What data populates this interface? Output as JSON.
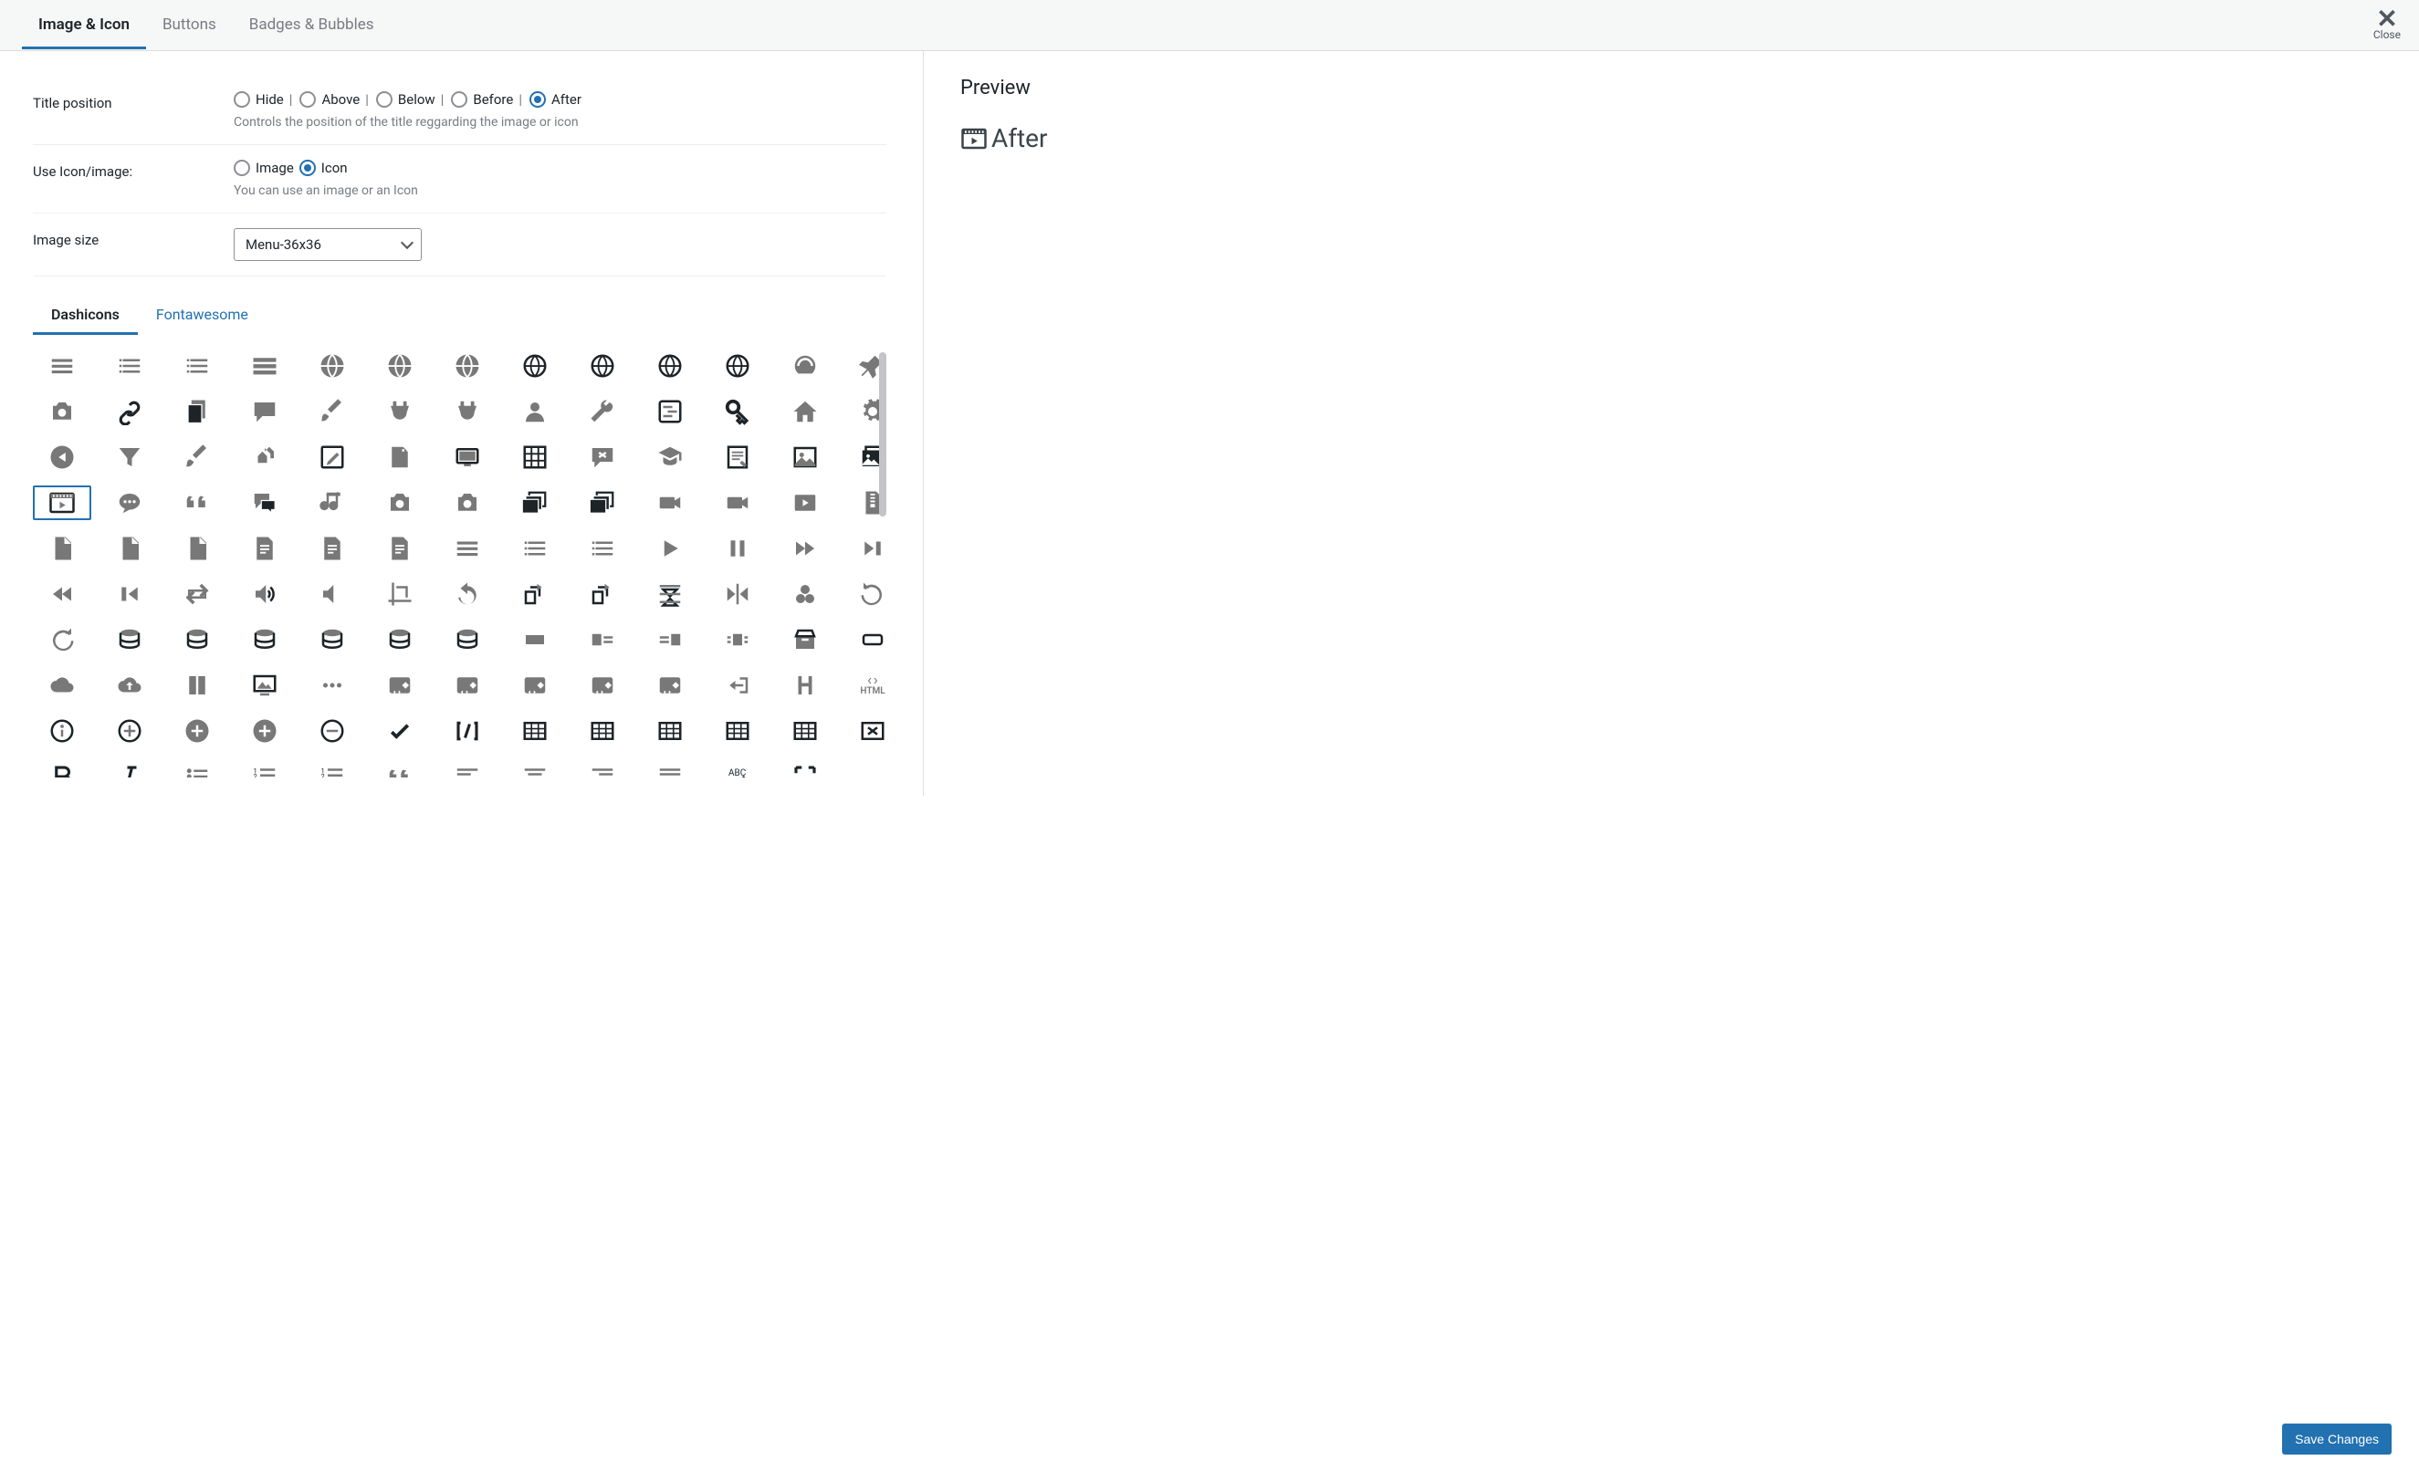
{
  "header": {
    "tabs": [
      "Image & Icon",
      "Buttons",
      "Badges & Bubbles"
    ],
    "active_tab": 0,
    "close_label": "Close"
  },
  "fields": {
    "title_position": {
      "label": "Title position",
      "options": [
        "Hide",
        "Above",
        "Below",
        "Before",
        "After"
      ],
      "selected": 4,
      "desc": "Controls the position of the title reggarding the image or icon"
    },
    "use_icon": {
      "label": "Use Icon/image:",
      "options": [
        "Image",
        "Icon"
      ],
      "selected": 1,
      "desc": "You can use an image or an Icon"
    },
    "image_size": {
      "label": "Image size",
      "value": "Menu-36x36"
    }
  },
  "icon_tabs": {
    "items": [
      "Dashicons",
      "Fontawesome"
    ],
    "active": 0
  },
  "icons": [
    "menu",
    "menu-alt",
    "menu-alt2",
    "menu-alt3",
    "site",
    "site-alt",
    "site-alt2",
    "site-alt3",
    "globe",
    "globe2",
    "globe3",
    "dashboard",
    "pin",
    "media",
    "links",
    "page",
    "comment",
    "brush",
    "plugin",
    "plugin-checked",
    "user",
    "wrench",
    "settings",
    "key",
    "home",
    "gear",
    "play-back",
    "filter",
    "brush2",
    "multisite",
    "edit",
    "add-page",
    "slides",
    "grid",
    "dismiss",
    "learn-more",
    "text-page",
    "image",
    "gallery",
    "video",
    "chat",
    "quote",
    "chat-alt",
    "audio",
    "camera",
    "camera-alt",
    "images",
    "images-alt",
    "video-rec",
    "video-alt",
    "video-play",
    "archive",
    "audio-file",
    "code-file",
    "file",
    "document",
    "spreadsheet",
    "document-alt",
    "text",
    "playlist-audio",
    "playlist-video",
    "play",
    "pause",
    "fast-forward",
    "step-forward",
    "rewind",
    "step-back",
    "repeat",
    "volume",
    "volume-off",
    "crop",
    "undo-alt",
    "rotate",
    "rotate-right",
    "flip-v",
    "flip-h",
    "filter-alt",
    "undo",
    "redo",
    "db-add",
    "db",
    "db-import",
    "db-export",
    "db-view",
    "db-check",
    "table",
    "align-left",
    "align-right",
    "align-center",
    "storage",
    "tablet",
    "cloud",
    "cloud-upload",
    "book",
    "screen",
    "more",
    "embed-generic",
    "embed-post",
    "embed-photo",
    "embed-video",
    "embed-audio",
    "exit",
    "heading",
    "html",
    "info",
    "plus",
    "plus-alt",
    "plus-alt2",
    "minus",
    "check",
    "shortcode",
    "table-col-after",
    "table-col-before",
    "table-col-delete",
    "table-row-after",
    "table-row-before",
    "table-row-delete",
    "bold",
    "italic",
    "list",
    "list-ol",
    "list-ol-rtl",
    "quote-alt",
    "align-left2",
    "align-center2",
    "align-right2",
    "align-justify",
    "spellcheck",
    "fullscreen"
  ],
  "selected_icon": "video",
  "preview": {
    "title": "Preview",
    "text": "After"
  },
  "footer": {
    "save": "Save Changes"
  }
}
